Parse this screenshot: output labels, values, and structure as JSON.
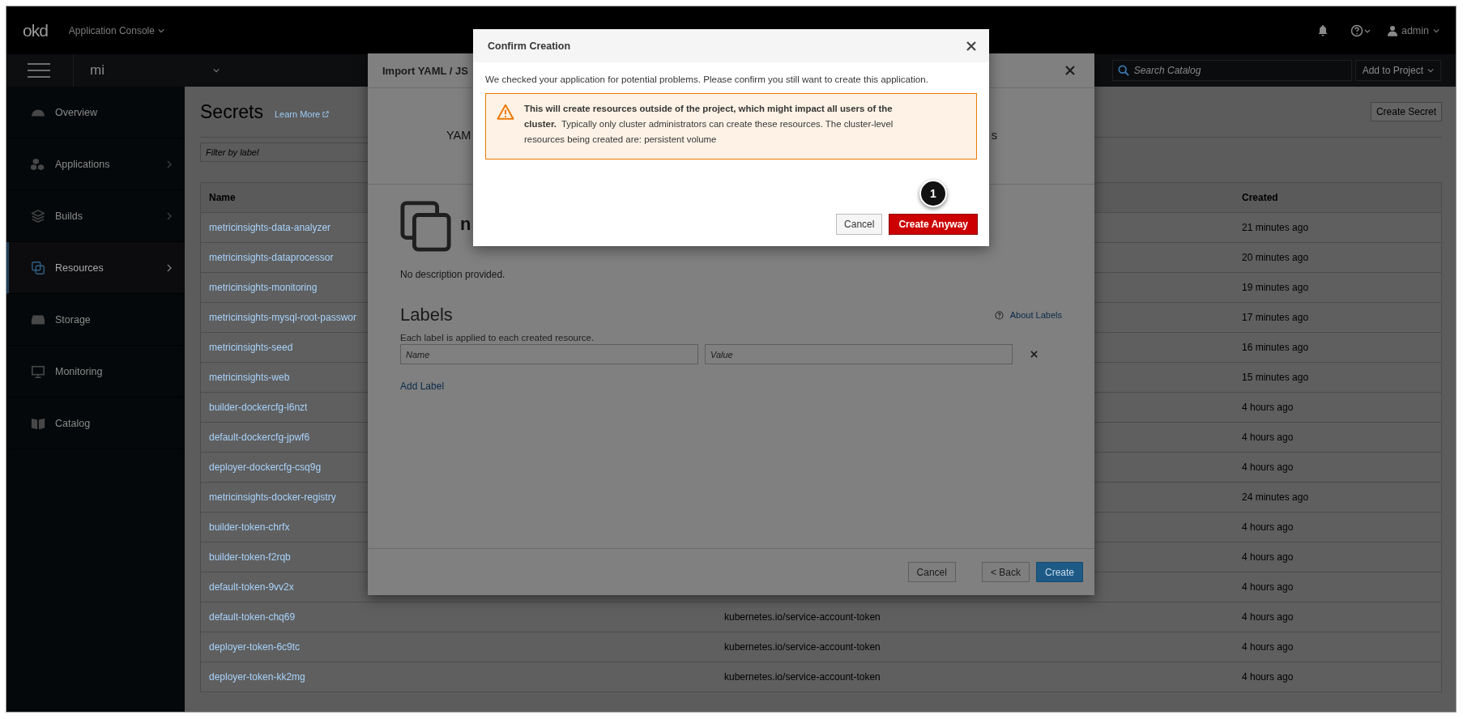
{
  "top_bar": {
    "logo": "okd",
    "app_switcher": "Application Console",
    "user": "admin"
  },
  "project_bar": {
    "project": "mi",
    "search": {
      "placeholder": "Search Catalog"
    },
    "add_button": "Add to Project"
  },
  "sidebar": {
    "items": [
      {
        "label": "Overview",
        "selected": false,
        "expandable": false
      },
      {
        "label": "Applications",
        "selected": false,
        "expandable": true
      },
      {
        "label": "Builds",
        "selected": false,
        "expandable": true
      },
      {
        "label": "Resources",
        "selected": true,
        "expandable": true
      },
      {
        "label": "Storage",
        "selected": false,
        "expandable": false
      },
      {
        "label": "Monitoring",
        "selected": false,
        "expandable": false
      },
      {
        "label": "Catalog",
        "selected": false,
        "expandable": false
      }
    ]
  },
  "page": {
    "title": "Secrets",
    "learn_more": "Learn More",
    "create_button": "Create Secret",
    "filter": {
      "placeholder": "Filter by label"
    },
    "table": {
      "columns": [
        "Name",
        "Created"
      ],
      "rows": [
        {
          "name": "metricinsights-data-analyzer",
          "created": "21 minutes ago"
        },
        {
          "name": "metricinsights-dataprocessor",
          "created": "20 minutes ago"
        },
        {
          "name": "metricinsights-monitoring",
          "created": "19 minutes ago"
        },
        {
          "name": "metricinsights-mysql-root-passwor",
          "created": "17 minutes ago"
        },
        {
          "name": "metricinsights-seed",
          "created": "16 minutes ago"
        },
        {
          "name": "metricinsights-web",
          "created": "15 minutes ago"
        },
        {
          "name": "builder-dockercfg-l6nzt",
          "created": "4 hours ago"
        },
        {
          "name": "default-dockercfg-jpwf6",
          "created": "4 hours ago"
        },
        {
          "name": "deployer-dockercfg-csq9g",
          "created": "4 hours ago"
        },
        {
          "name": "metricinsights-docker-registry",
          "created": "24 minutes ago"
        },
        {
          "name": "builder-token-chrfx",
          "created": "4 hours ago"
        },
        {
          "name": "builder-token-f2rqb",
          "created": "4 hours ago"
        },
        {
          "name": "default-token-9vv2x",
          "created": "4 hours ago"
        },
        {
          "name": "default-token-chq69",
          "type": "kubernetes.io/service-account-token",
          "created": "4 hours ago"
        },
        {
          "name": "deployer-token-6c9tc",
          "type": "kubernetes.io/service-account-token",
          "created": "4 hours ago"
        },
        {
          "name": "deployer-token-kk2mg",
          "type": "kubernetes.io/service-account-token",
          "created": "4 hours ago"
        }
      ]
    }
  },
  "import_dialog": {
    "title": "Import YAML / JS",
    "steps": [
      "YAM",
      "s"
    ],
    "item_name": "n",
    "description": "No description provided.",
    "labels_heading": "Labels",
    "about_labels": "About Labels",
    "labels_hint": "Each label is applied to each created resource.",
    "name_field": {
      "placeholder": "Name"
    },
    "value_field": {
      "placeholder": "Value"
    },
    "add_label": "Add Label",
    "buttons": {
      "cancel": "Cancel",
      "back": "< Back",
      "create": "Create"
    }
  },
  "confirm_dialog": {
    "title": "Confirm Creation",
    "message": "We checked your application for potential problems. Please confirm you still want to create this application.",
    "warning": "**This will create resources outside of the project, which might impact all users of the cluster.**  Typically only cluster administrators can create these resources. The cluster-level resources being created are: persistent volume",
    "buttons": {
      "cancel": "Cancel",
      "confirm": "Create Anyway"
    }
  },
  "callout": {
    "number": "1"
  }
}
